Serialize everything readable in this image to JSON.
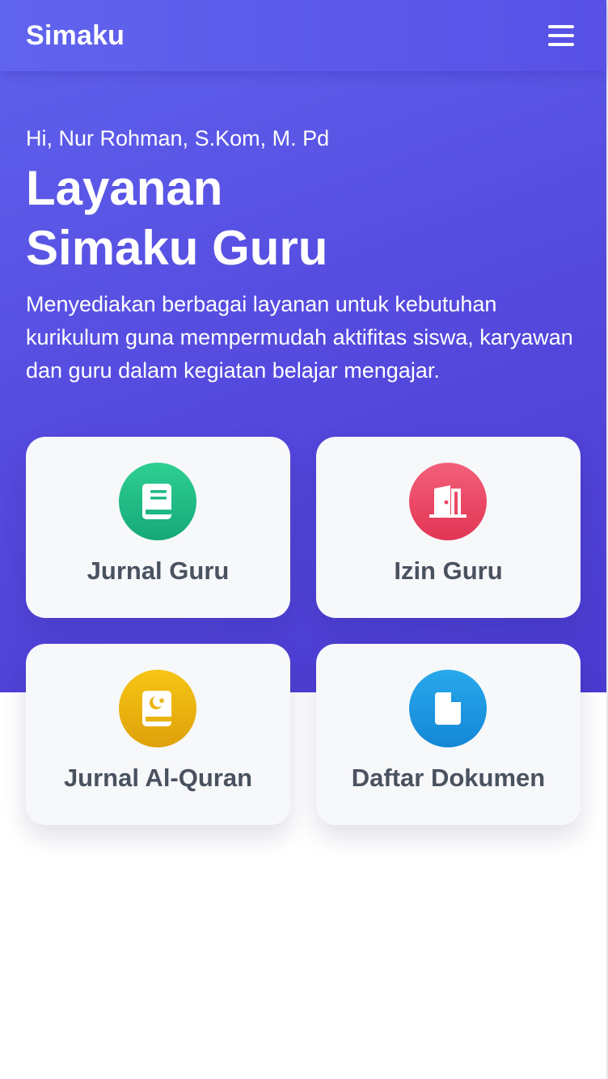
{
  "app": {
    "brand": "Simaku"
  },
  "hero": {
    "greeting": "Hi, Nur Rohman, S.Kom, M. Pd",
    "title_line1": "Layanan",
    "title_line2": "Simaku Guru",
    "description": "Menyediakan berbagai layanan untuk kebutuhan kurikulum guna mempermudah aktifitas siswa, karyawan dan guru dalam kegiatan belajar mengajar."
  },
  "menu": [
    {
      "label": "Jurnal Guru",
      "icon": "book-icon",
      "color": "#1fb982"
    },
    {
      "label": "Izin Guru",
      "icon": "door-exit-icon",
      "color": "#ea4663"
    },
    {
      "label": "Jurnal Al-Quran",
      "icon": "quran-icon",
      "color": "#eab30f"
    },
    {
      "label": "Daftar Dokumen",
      "icon": "document-icon",
      "color": "#1d98e2"
    }
  ]
}
